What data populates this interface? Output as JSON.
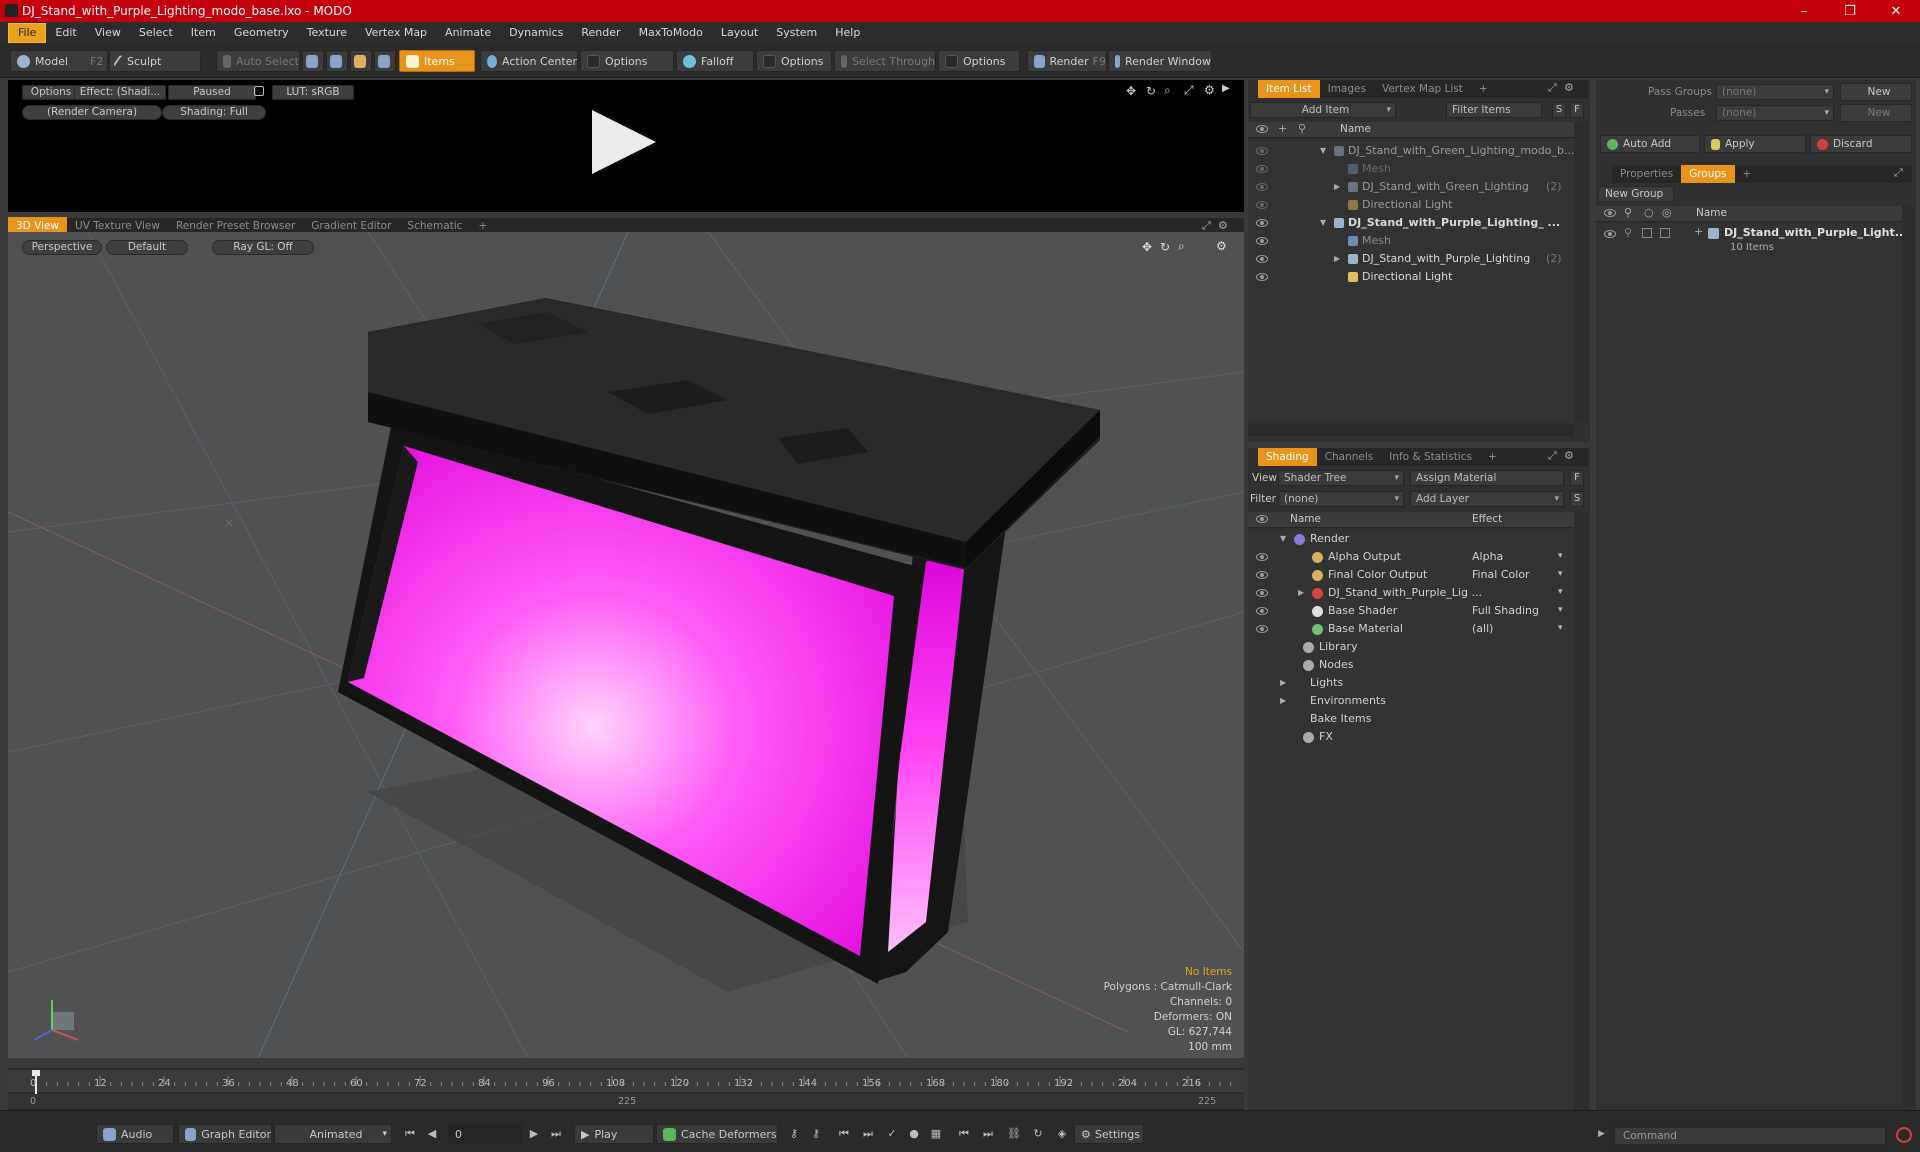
{
  "window": {
    "title": "DJ_Stand_with_Purple_Lighting_modo_base.lxo - MODO",
    "minimize": "–",
    "maximize": "❐",
    "close": "✕"
  },
  "menu": [
    "File",
    "Edit",
    "View",
    "Select",
    "Item",
    "Geometry",
    "Texture",
    "Vertex Map",
    "Animate",
    "Dynamics",
    "Render",
    "MaxToModo",
    "Layout",
    "System",
    "Help"
  ],
  "toolbar": {
    "model": "Model",
    "model_key": "F2",
    "sculpt": "Sculpt",
    "auto_select": "Auto Select",
    "items": "Items",
    "action_center": "Action Center",
    "options1": "Options",
    "falloff": "Falloff",
    "options2": "Options",
    "select_through": "Select Through",
    "options3": "Options",
    "render": "Render",
    "render_key": "F9",
    "render_window": "Render Window"
  },
  "preview": {
    "options": "Options",
    "effect": "Effect: (Shadi...",
    "paused": "Paused",
    "lut": "LUT: sRGB",
    "camera": "(Render Camera)",
    "shading": "Shading: Full"
  },
  "view_tabs": [
    "3D View",
    "UV Texture View",
    "Render Preset Browser",
    "Gradient Editor",
    "Schematic",
    "+"
  ],
  "viewport": {
    "perspective": "Perspective",
    "default": "Default",
    "raygl": "Ray GL: Off",
    "stats": {
      "no_items": "No Items",
      "polygons": "Polygons : Catmull-Clark",
      "channels": "Channels: 0",
      "deformers": "Deformers: ON",
      "gl": "GL: 627,744",
      "scale": "100 mm"
    }
  },
  "item_list": {
    "tabs": [
      "Item List",
      "Images",
      "Vertex Map List",
      "+"
    ],
    "add_item": "Add Item",
    "filter_items": "Filter Items",
    "s": "S",
    "f": "F",
    "col_name": "Name",
    "rows": [
      {
        "label": "DJ_Stand_with_Green_Lighting_modo_b...",
        "indent": 0,
        "expand": "▼",
        "dim": true
      },
      {
        "label": "Mesh",
        "indent": 1,
        "expand": "",
        "dim": true
      },
      {
        "label": "DJ_Stand_with_Green_Lighting",
        "count": "(2)",
        "indent": 1,
        "expand": "▶",
        "dim": true
      },
      {
        "label": "Directional Light",
        "indent": 1,
        "expand": "",
        "dim": true
      },
      {
        "label": "DJ_Stand_with_Purple_Lighting_ ...",
        "indent": 0,
        "expand": "▼",
        "dim": false,
        "bold": true
      },
      {
        "label": "Mesh",
        "indent": 1,
        "expand": "",
        "dim": false
      },
      {
        "label": "DJ_Stand_with_Purple_Lighting",
        "count": "(2)",
        "indent": 1,
        "expand": "▶",
        "dim": false
      },
      {
        "label": "Directional Light",
        "indent": 1,
        "expand": "",
        "dim": false
      }
    ]
  },
  "shading": {
    "tabs": [
      "Shading",
      "Channels",
      "Info & Statistics",
      "+"
    ],
    "view_label": "View",
    "view_value": "Shader Tree",
    "assign_material": "Assign Material",
    "f": "F",
    "filter_label": "Filter",
    "filter_value": "(none)",
    "add_layer": "Add Layer",
    "s": "S",
    "col_name": "Name",
    "col_effect": "Effect",
    "rows": [
      {
        "label": "Render",
        "effect": "",
        "indent": 0,
        "expand": "▼",
        "eye": false
      },
      {
        "label": "Alpha Output",
        "effect": "Alpha",
        "indent": 1,
        "expand": "",
        "eye": true
      },
      {
        "label": "Final Color Output",
        "effect": "Final Color",
        "indent": 1,
        "expand": "",
        "eye": true
      },
      {
        "label": "DJ_Stand_with_Purple_Lig ...",
        "effect": "",
        "indent": 1,
        "expand": "▶",
        "eye": true
      },
      {
        "label": "Base Shader",
        "effect": "Full Shading",
        "indent": 1,
        "expand": "",
        "eye": true
      },
      {
        "label": "Base Material",
        "effect": "(all)",
        "indent": 1,
        "expand": "",
        "eye": true
      },
      {
        "label": "Library",
        "effect": "",
        "indent": 0.5,
        "expand": "",
        "eye": false
      },
      {
        "label": "Nodes",
        "effect": "",
        "indent": 0.5,
        "expand": "",
        "eye": false
      },
      {
        "label": "Lights",
        "effect": "",
        "indent": 0,
        "expand": "▶",
        "eye": false
      },
      {
        "label": "Environments",
        "effect": "",
        "indent": 0,
        "expand": "▶",
        "eye": false
      },
      {
        "label": "Bake Items",
        "effect": "",
        "indent": 0,
        "expand": "",
        "eye": false
      },
      {
        "label": "FX",
        "effect": "",
        "indent": 0.5,
        "expand": "",
        "eye": false
      }
    ]
  },
  "right_panel": {
    "pass_groups_label": "Pass Groups",
    "pass_groups_value": "(none)",
    "new1": "New",
    "passes_label": "Passes",
    "passes_value": "(none)",
    "new2": "New",
    "auto_add": "Auto Add",
    "apply": "Apply",
    "discard": "Discard",
    "tabs": [
      "Properties",
      "Groups",
      "+"
    ],
    "new_group": "New Group",
    "col_name": "Name",
    "group_name": "DJ_Stand_with_Purple_Light...",
    "group_items": "10 Items"
  },
  "timeline": {
    "ticks": [
      "0",
      "12",
      "24",
      "36",
      "48",
      "60",
      "72",
      "84",
      "96",
      "108",
      "120",
      "132",
      "144",
      "156",
      "168",
      "180",
      "192",
      "204",
      "216"
    ],
    "start": "0",
    "mid": "225",
    "end": "225"
  },
  "bottom": {
    "audio": "Audio",
    "graph_editor": "Graph Editor",
    "animated": "Animated",
    "frame": "0",
    "play": "Play",
    "cache_deformers": "Cache Deformers",
    "settings": "Settings",
    "command": "Command"
  },
  "colors": {
    "accent": "#e8941a",
    "titlebar": "#c4000c",
    "magenta": "#ff2cf5"
  }
}
